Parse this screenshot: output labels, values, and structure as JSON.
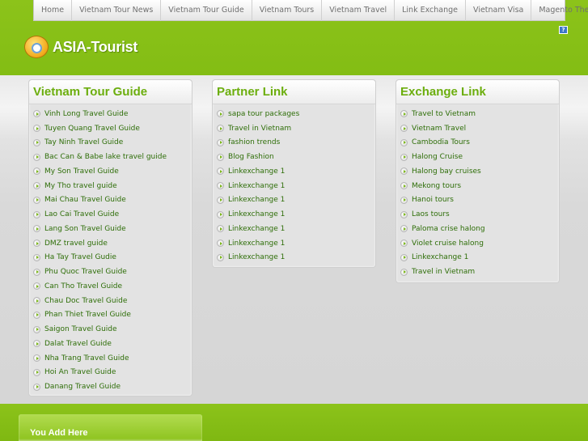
{
  "nav": {
    "items": [
      "Home",
      "Vietnam Tour News",
      "Vietnam Tour Guide",
      "Vietnam Tours",
      "Vietnam Travel",
      "Link Exchange",
      "Vietnam Visa",
      "Magento Theme"
    ],
    "help_label": "?"
  },
  "logo": {
    "text": "ASIA-Tourist"
  },
  "boxes": [
    {
      "title": "Vietnam Tour Guide",
      "items": [
        "Vinh Long Travel Guide",
        "Tuyen Quang Travel Guide",
        "Tay Ninh Travel Guide",
        "Bac Can & Babe lake travel guide",
        "My Son Travel Guide",
        "My Tho travel guide",
        "Mai Chau Travel Guide",
        "Lao Cai Travel Guide",
        "Lang Son Travel Guide",
        "DMZ travel guide",
        "Ha Tay Travel Gudie",
        "Phu Quoc Travel Guide",
        "Can Tho Travel Guide",
        "Chau Doc Travel Guide",
        "Phan Thiet Travel Guide",
        "Saigon Travel Guide",
        "Dalat Travel Guide",
        "Nha Trang Travel Guide",
        "Hoi An Travel Guide",
        "Danang Travel Guide"
      ]
    },
    {
      "title": "Partner Link",
      "items": [
        "sapa tour packages",
        "Travel in Vietnam",
        "fashion trends",
        "Blog Fashion",
        "Linkexchange 1",
        "Linkexchange 1",
        "Linkexchange 1",
        "Linkexchange 1",
        "Linkexchange 1",
        "Linkexchange 1",
        "Linkexchange 1"
      ]
    },
    {
      "title": "Exchange Link",
      "items": [
        "Travel to Vietnam",
        "Vietnam Travel",
        "Cambodia Tours",
        "Halong Cruise",
        "Halong bay cruises",
        "Mekong tours",
        "Hanoi tours",
        "Laos tours",
        "Paloma crise halong",
        "Violet cruise halong",
        "Linkexchange 1",
        "Travel in Vietnam"
      ]
    }
  ],
  "footer": {
    "you_add_label": "You Add Here"
  },
  "colors": {
    "brand_green": "#8cc31a",
    "title_green": "#6cae0e",
    "link_green": "#2e6e08"
  }
}
